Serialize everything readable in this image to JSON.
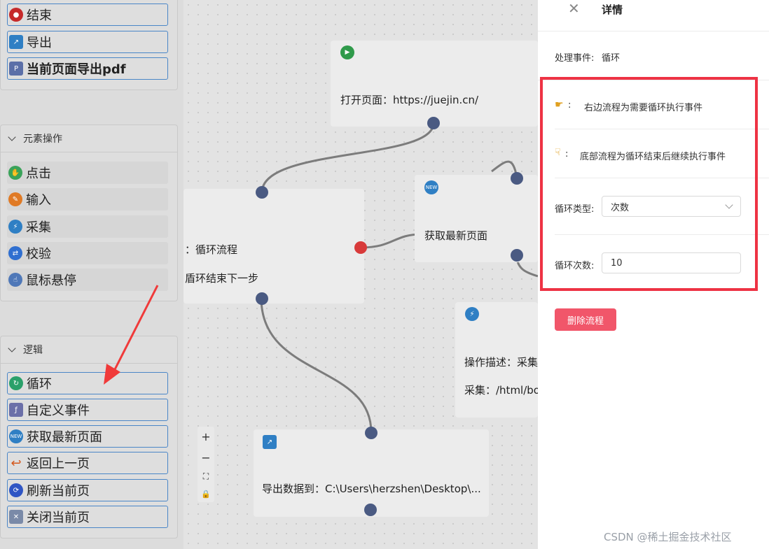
{
  "sidebar": {
    "top_items": [
      {
        "label": "结束",
        "icon": "end-icon"
      },
      {
        "label": "导出",
        "icon": "export-icon"
      },
      {
        "label": "当前页面导出pdf",
        "icon": "pdf-icon"
      }
    ],
    "element_section": {
      "title": "元素操作",
      "items": [
        {
          "label": "点击",
          "icon": "click-icon"
        },
        {
          "label": "输入",
          "icon": "input-icon"
        },
        {
          "label": "采集",
          "icon": "collect-icon"
        },
        {
          "label": "校验",
          "icon": "verify-icon"
        },
        {
          "label": "鼠标悬停",
          "icon": "hover-icon"
        }
      ]
    },
    "logic_section": {
      "title": "逻辑",
      "items": [
        {
          "label": "循环",
          "icon": "loop-icon"
        },
        {
          "label": "自定义事件",
          "icon": "custom-event-icon"
        },
        {
          "label": "获取最新页面",
          "icon": "new-page-icon"
        },
        {
          "label": "返回上一页",
          "icon": "back-icon"
        },
        {
          "label": "刷新当前页",
          "icon": "refresh-icon"
        },
        {
          "label": "关闭当前页",
          "icon": "close-page-icon"
        }
      ]
    }
  },
  "canvas": {
    "nodes": {
      "open_page": "打开页面：https://juejin.cn/",
      "loop_flow": "：循环流程",
      "loop_next": "盾环结束下一步",
      "get_latest": "获取最新页面",
      "op_desc": "操作描述：采集",
      "collect_path": "采集：/html/bo",
      "export_data": "导出数据到：C:\\Users\\herzshen\\Desktop\\..."
    },
    "zoom_controls": [
      "+",
      "−",
      "⛶",
      "🔒"
    ]
  },
  "detail": {
    "title": "详情",
    "event_label": "处理事件:",
    "event_value": "循环",
    "hint_right": "右边流程为需要循环执行事件",
    "hint_bottom": "底部流程为循环结束后继续执行事件",
    "loop_type_label": "循环类型:",
    "loop_type_value": "次数",
    "loop_count_label": "循环次数:",
    "loop_count_value": "10",
    "delete_label": "删除流程"
  },
  "watermark": "CSDN @稀土掘金技术社区"
}
